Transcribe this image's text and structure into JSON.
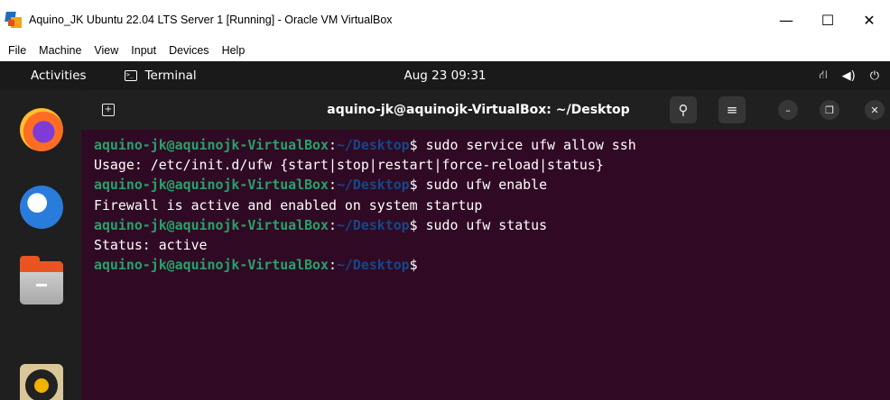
{
  "host_window": {
    "title": "Aquino_JK Ubuntu 22.04 LTS Server 1 [Running] - Oracle VM VirtualBox",
    "controls": {
      "minimize": "—",
      "maximize": "☐",
      "close": "✕"
    }
  },
  "menubar": {
    "items": [
      "File",
      "Machine",
      "View",
      "Input",
      "Devices",
      "Help"
    ]
  },
  "gnome_topbar": {
    "activities": "Activities",
    "app_name": "Terminal",
    "clock": "Aug 23  09:31",
    "tray": {
      "network": "⛙",
      "volume": "◀)",
      "power": "⏻"
    }
  },
  "terminal": {
    "title": "aquino-jk@aquinojk-VirtualBox: ~/Desktop",
    "buttons": {
      "new_tab": "+",
      "search": "⚲",
      "menu": "≡",
      "minimize": "–",
      "restore": "❐",
      "close": "✕"
    },
    "prompt": {
      "user_host": "aquino-jk@aquinojk-VirtualBox",
      "colon": ":",
      "path": "~/Desktop",
      "symbol": "$"
    },
    "lines": [
      {
        "type": "cmd",
        "text": " sudo service ufw allow ssh"
      },
      {
        "type": "out",
        "text": "Usage: /etc/init.d/ufw {start|stop|restart|force-reload|status}"
      },
      {
        "type": "cmd",
        "text": " sudo ufw enable"
      },
      {
        "type": "out",
        "text": "Firewall is active and enabled on system startup"
      },
      {
        "type": "cmd",
        "text": " sudo ufw status"
      },
      {
        "type": "out",
        "text": "Status: active"
      },
      {
        "type": "cmd",
        "text": " "
      }
    ]
  },
  "dock": {
    "apps": [
      "firefox-icon",
      "thunderbird-icon",
      "files-icon",
      "rhythmbox-icon"
    ]
  },
  "colors": {
    "terminal_bg": "#300a24",
    "prompt_user": "#26a269",
    "prompt_path": "#12488b",
    "topbar_bg": "#1a1a1a",
    "dock_bg": "#1f1f1f"
  }
}
